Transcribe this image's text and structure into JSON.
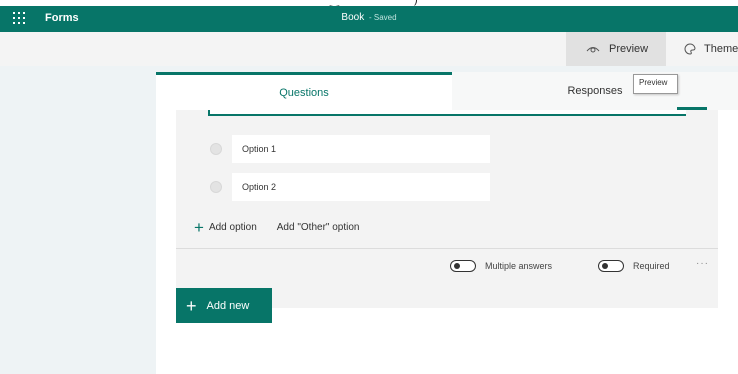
{
  "header": {
    "app_name": "Forms",
    "doc_title": "Book",
    "saved_status": "- Saved"
  },
  "commandbar": {
    "preview_label": "Preview",
    "theme_label": "Theme"
  },
  "tabs": {
    "questions_label": "Questions",
    "responses_label": "Responses"
  },
  "tooltip": {
    "text": "Preview"
  },
  "question": {
    "options": [
      {
        "value": "Option 1"
      },
      {
        "value": "Option 2"
      }
    ],
    "add_option_label": "Add option",
    "add_other_label": "Add \"Other\" option",
    "multiple_answers_label": "Multiple answers",
    "required_label": "Required",
    "more_label": "···"
  },
  "add_new": {
    "label": "Add new"
  },
  "colors": {
    "brand": "#077568"
  },
  "icons": {
    "waffle": "app-launcher-icon",
    "preview": "eye-icon",
    "theme": "palette-icon",
    "plus": "plus-icon"
  }
}
